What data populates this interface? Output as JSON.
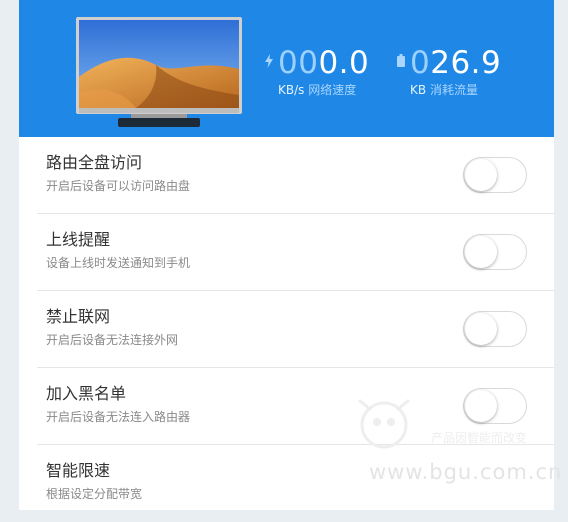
{
  "header": {
    "speed": {
      "value_dim": "00",
      "value_main": "0.0",
      "unit": "KB/s",
      "label": "网络速度"
    },
    "usage": {
      "value_dim": "0",
      "value_main": "26.9",
      "unit": "KB",
      "label": "消耗流量"
    }
  },
  "settings": [
    {
      "title": "路由全盘访问",
      "description": "开启后设备可以访问路由盘",
      "toggle_on": false
    },
    {
      "title": "上线提醒",
      "description": "设备上线时发送通知到手机",
      "toggle_on": false
    },
    {
      "title": "禁止联网",
      "description": "开启后设备无法连接外网",
      "toggle_on": false
    },
    {
      "title": "加入黑名单",
      "description": "开启后设备无法连入路由器",
      "toggle_on": false
    },
    {
      "title": "智能限速",
      "description": "根据设定分配带宽"
    }
  ],
  "watermark": {
    "slogan": "产品因智能而改变",
    "url": "www.bgu.com.cn"
  },
  "colors": {
    "header_bg": "#1f87e6",
    "text_primary": "#333333",
    "text_secondary": "#8a8a8a"
  },
  "icons": {
    "device": "tv-icon",
    "speed": "lightning-icon",
    "usage": "battery-icon"
  }
}
